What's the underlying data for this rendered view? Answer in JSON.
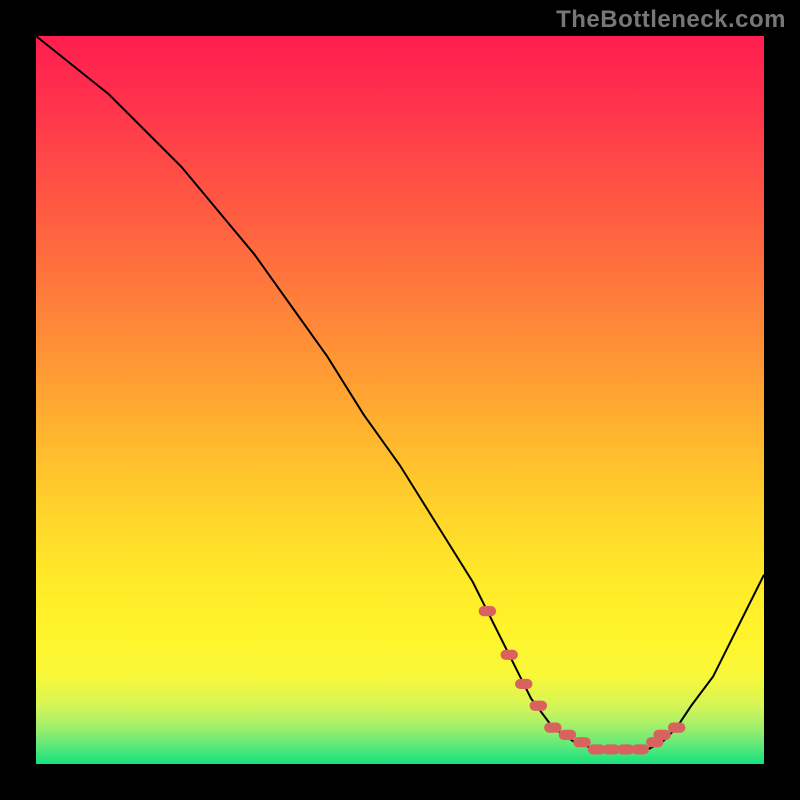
{
  "watermark": "TheBottleneck.com",
  "chart_data": {
    "type": "line",
    "title": "",
    "xlabel": "",
    "ylabel": "",
    "xlim": [
      0,
      100
    ],
    "ylim": [
      0,
      100
    ],
    "grid": false,
    "legend": false,
    "series": [
      {
        "name": "bottleneck-curve",
        "color": "#000000",
        "x": [
          0,
          5,
          10,
          15,
          20,
          25,
          30,
          35,
          40,
          45,
          50,
          55,
          60,
          62,
          65,
          68,
          71,
          74,
          77,
          80,
          82,
          84,
          86,
          88,
          90,
          93,
          96,
          100
        ],
        "y": [
          100,
          96,
          92,
          87,
          82,
          76,
          70,
          63,
          56,
          48,
          41,
          33,
          25,
          21,
          15,
          9,
          5,
          3,
          2,
          2,
          2,
          2,
          3,
          5,
          8,
          12,
          18,
          26
        ]
      },
      {
        "name": "sweet-spot-markers",
        "color": "#d9625e",
        "style": "markers",
        "x": [
          62,
          65,
          67,
          69,
          71,
          73,
          75,
          77,
          79,
          81,
          83,
          85,
          86,
          88
        ],
        "y": [
          21,
          15,
          11,
          8,
          5,
          4,
          3,
          2,
          2,
          2,
          2,
          3,
          4,
          5
        ]
      }
    ],
    "background_gradient_stops": [
      {
        "offset": 0.0,
        "color": "#ff1f4f"
      },
      {
        "offset": 0.06,
        "color": "#ff2a4e"
      },
      {
        "offset": 0.14,
        "color": "#ff4049"
      },
      {
        "offset": 0.24,
        "color": "#ff5b42"
      },
      {
        "offset": 0.35,
        "color": "#ff7a3b"
      },
      {
        "offset": 0.46,
        "color": "#ff9a34"
      },
      {
        "offset": 0.56,
        "color": "#ffb92e"
      },
      {
        "offset": 0.66,
        "color": "#ffd52a"
      },
      {
        "offset": 0.75,
        "color": "#ffea28"
      },
      {
        "offset": 0.82,
        "color": "#fff42a"
      },
      {
        "offset": 0.88,
        "color": "#f7f83a"
      },
      {
        "offset": 0.92,
        "color": "#d6f556"
      },
      {
        "offset": 0.95,
        "color": "#9fef6b"
      },
      {
        "offset": 0.975,
        "color": "#5de97a"
      },
      {
        "offset": 1.0,
        "color": "#17e07d"
      }
    ]
  }
}
